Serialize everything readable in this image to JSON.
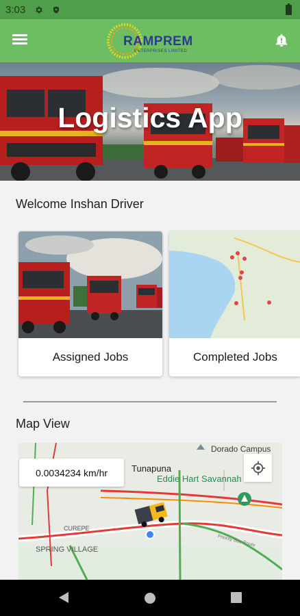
{
  "status_bar": {
    "time": "3:03"
  },
  "app_bar": {
    "logo_text": "RAMPREM",
    "logo_subtext": "ENTERPRISES LIMITED"
  },
  "hero": {
    "title": "Logistics App"
  },
  "welcome_text": "Welcome Inshan Driver",
  "cards": [
    {
      "label": "Assigned Jobs"
    },
    {
      "label": "Completed Jobs"
    }
  ],
  "map_section": {
    "title": "Map View",
    "speed": "0.0034234 km/hr",
    "labels": {
      "dorado": "Dorado Campus",
      "tunapuna": "Tunapuna",
      "eddie_hart": "Eddie Hart Savannah",
      "curepe": "CUREPE",
      "spring_village": "SPRING VILLAGE",
      "highway": "Priority Bus Route"
    }
  },
  "colors": {
    "status_bar": "#4f9e4a",
    "app_bar": "#6dbe63",
    "logo_blue": "#2c3b8e"
  }
}
